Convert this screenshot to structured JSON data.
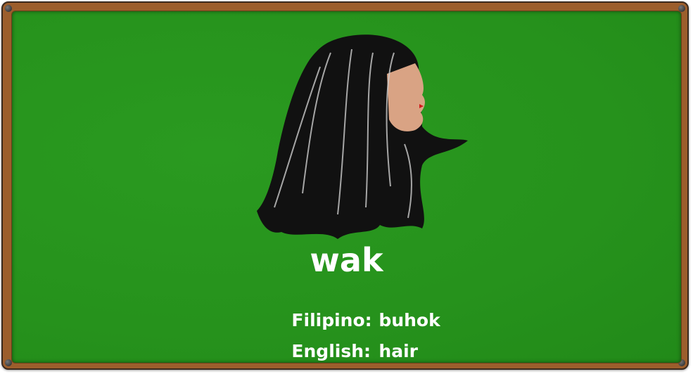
{
  "card": {
    "word": "wak",
    "filipino_label": "Filipino:",
    "filipino_value": "buhok",
    "english_label": "English:",
    "english_value": "hair",
    "image": "long-black-hair-woman-profile"
  },
  "colors": {
    "board": "#26921c",
    "frame": "#9c5e2c",
    "text": "#ffffff"
  }
}
